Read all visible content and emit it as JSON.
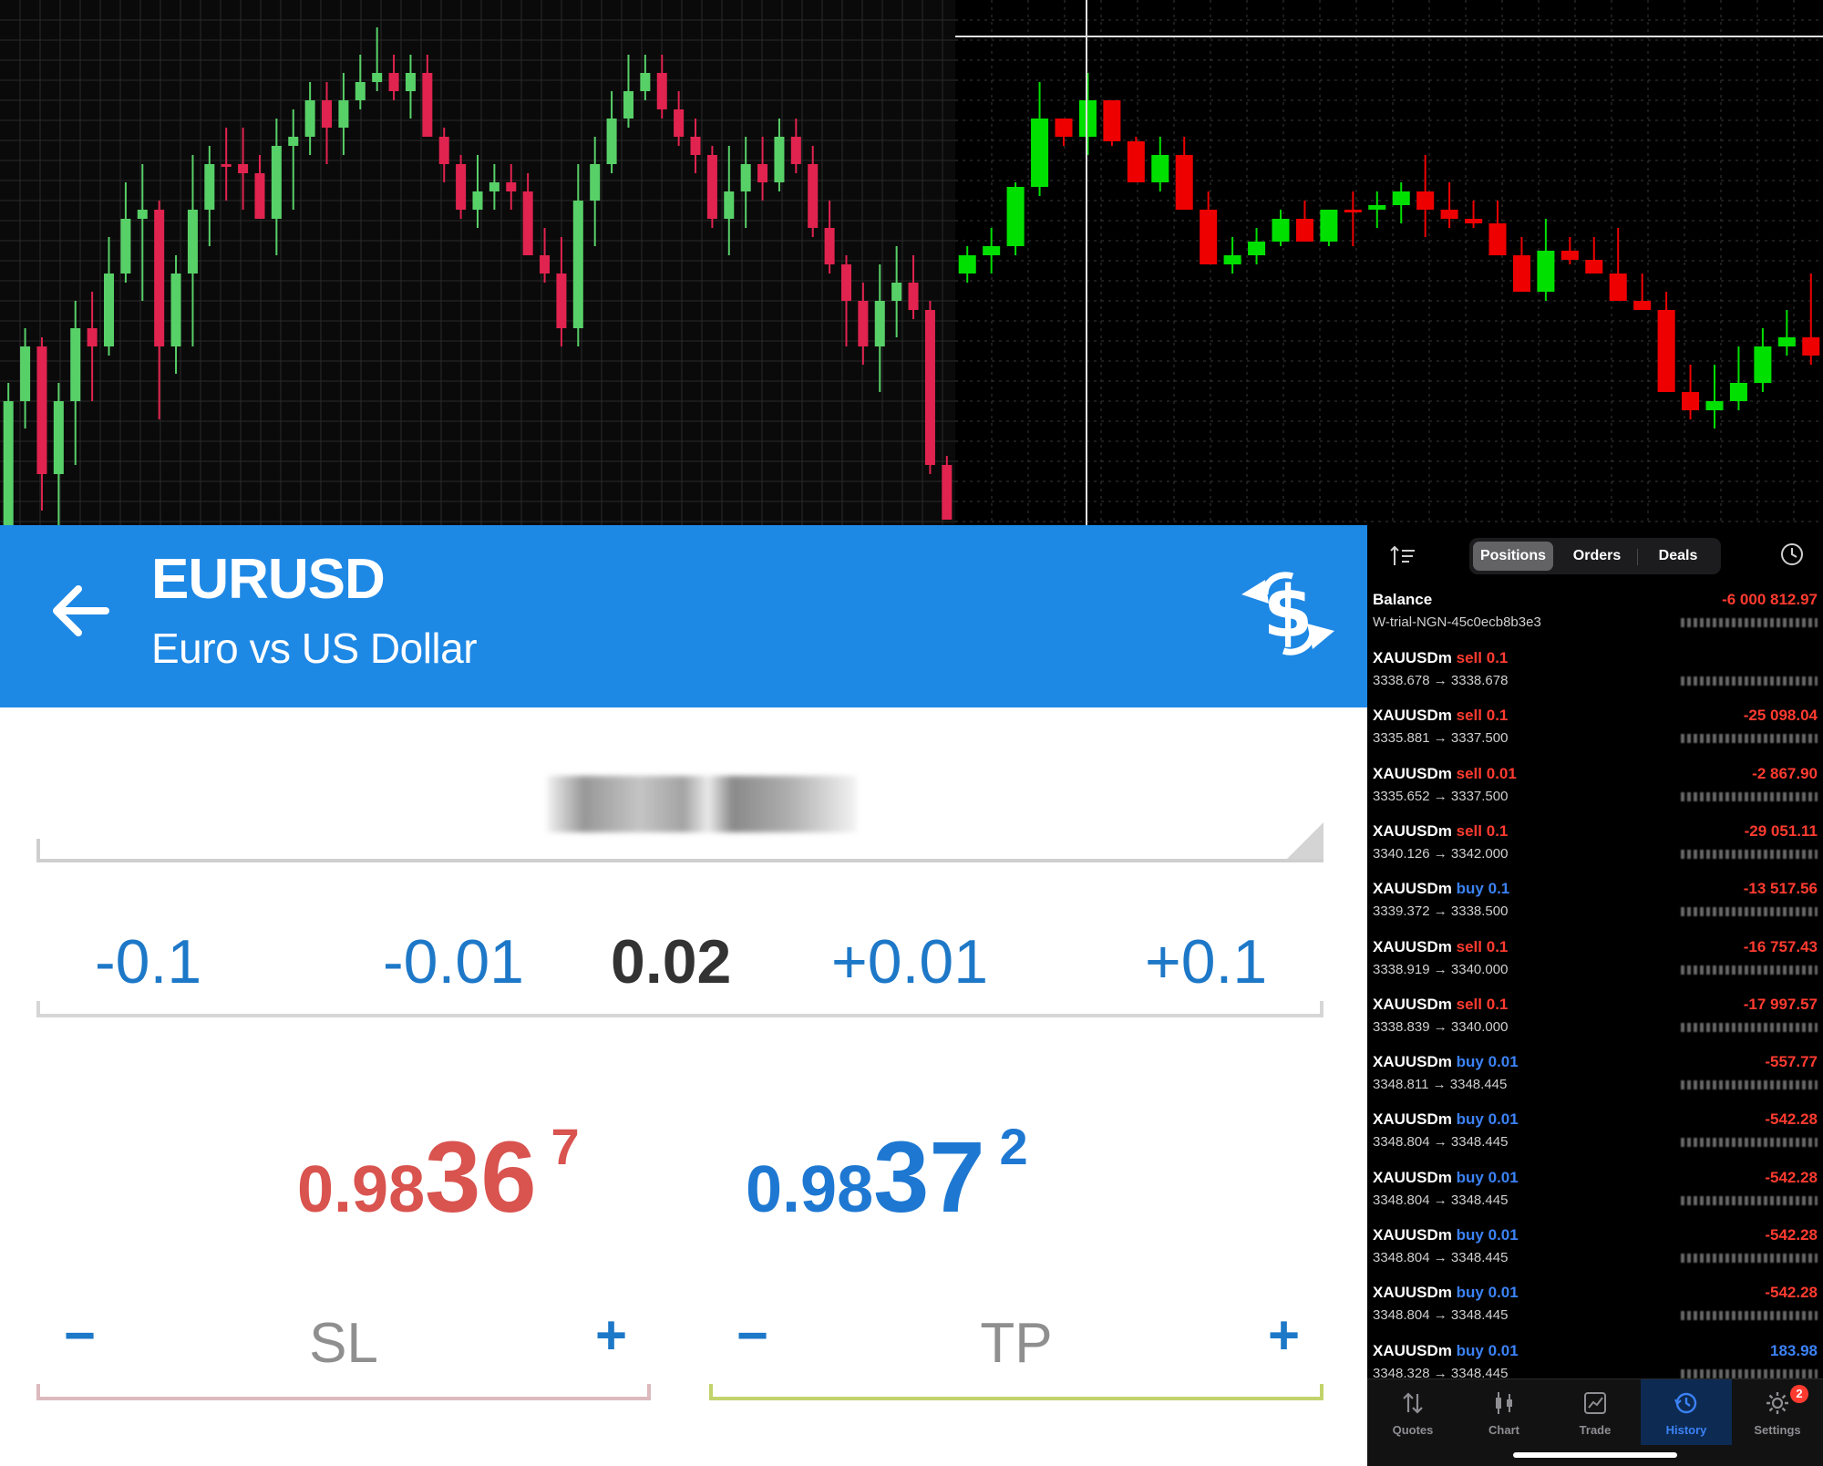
{
  "chart_data": [
    {
      "type": "candlestick",
      "title": "",
      "grid": true,
      "bullish_color": "#58d068",
      "bearish_color": "#e0234f",
      "background": "#0a0a0a",
      "ohlc": [
        [
          600,
          620,
          420,
          440
        ],
        [
          440,
          470,
          360,
          380
        ],
        [
          380,
          560,
          370,
          520
        ],
        [
          520,
          580,
          420,
          440
        ],
        [
          440,
          510,
          330,
          360
        ],
        [
          360,
          440,
          320,
          380
        ],
        [
          380,
          390,
          260,
          300
        ],
        [
          300,
          310,
          200,
          240
        ],
        [
          240,
          330,
          180,
          230
        ],
        [
          230,
          460,
          220,
          380
        ],
        [
          380,
          410,
          280,
          300
        ],
        [
          300,
          380,
          170,
          230
        ],
        [
          230,
          270,
          160,
          180
        ],
        [
          180,
          220,
          140,
          180
        ],
        [
          180,
          230,
          140,
          190
        ],
        [
          190,
          240,
          170,
          240
        ],
        [
          240,
          280,
          130,
          160
        ],
        [
          160,
          230,
          120,
          150
        ],
        [
          150,
          170,
          90,
          110
        ],
        [
          110,
          180,
          90,
          140
        ],
        [
          140,
          170,
          80,
          110
        ],
        [
          110,
          120,
          60,
          90
        ],
        [
          90,
          100,
          30,
          80
        ],
        [
          80,
          110,
          60,
          100
        ],
        [
          100,
          130,
          60,
          80
        ],
        [
          80,
          150,
          60,
          150
        ],
        [
          150,
          200,
          140,
          180
        ],
        [
          180,
          240,
          170,
          230
        ],
        [
          230,
          250,
          170,
          210
        ],
        [
          210,
          230,
          180,
          200
        ],
        [
          200,
          230,
          180,
          210
        ],
        [
          210,
          280,
          190,
          280
        ],
        [
          280,
          310,
          250,
          300
        ],
        [
          300,
          380,
          260,
          360
        ],
        [
          360,
          380,
          180,
          220
        ],
        [
          220,
          270,
          150,
          180
        ],
        [
          180,
          190,
          100,
          130
        ],
        [
          130,
          140,
          60,
          100
        ],
        [
          100,
          110,
          60,
          80
        ],
        [
          80,
          130,
          60,
          120
        ],
        [
          120,
          160,
          100,
          150
        ],
        [
          150,
          190,
          130,
          170
        ],
        [
          170,
          250,
          160,
          240
        ],
        [
          240,
          280,
          160,
          210
        ],
        [
          210,
          250,
          150,
          180
        ],
        [
          180,
          220,
          150,
          200
        ],
        [
          200,
          210,
          130,
          150
        ],
        [
          150,
          190,
          130,
          180
        ],
        [
          180,
          260,
          160,
          250
        ],
        [
          250,
          300,
          220,
          290
        ],
        [
          290,
          380,
          280,
          330
        ],
        [
          330,
          400,
          310,
          380
        ],
        [
          380,
          430,
          290,
          330
        ],
        [
          330,
          370,
          270,
          310
        ],
        [
          310,
          350,
          280,
          340
        ],
        [
          340,
          520,
          330,
          510
        ],
        [
          510,
          570,
          500,
          570
        ]
      ]
    },
    {
      "type": "candlestick",
      "title": "",
      "grid": true,
      "bullish_color": "#00e000",
      "bearish_color": "#ee0000",
      "background": "#000000",
      "ohlc": [
        [
          300,
          310,
          270,
          280
        ],
        [
          280,
          300,
          250,
          270
        ],
        [
          270,
          280,
          200,
          205
        ],
        [
          205,
          215,
          90,
          130
        ],
        [
          130,
          160,
          140,
          150
        ],
        [
          150,
          170,
          80,
          110
        ],
        [
          110,
          160,
          140,
          155
        ],
        [
          155,
          170,
          150,
          200
        ],
        [
          200,
          210,
          150,
          170
        ],
        [
          170,
          220,
          150,
          230
        ],
        [
          230,
          250,
          210,
          290
        ],
        [
          290,
          300,
          260,
          280
        ],
        [
          280,
          290,
          250,
          265
        ],
        [
          265,
          270,
          230,
          240
        ],
        [
          240,
          260,
          220,
          265
        ],
        [
          265,
          270,
          240,
          230
        ],
        [
          230,
          270,
          210,
          230
        ],
        [
          230,
          250,
          210,
          225
        ],
        [
          225,
          245,
          200,
          210
        ],
        [
          210,
          260,
          170,
          230
        ],
        [
          230,
          250,
          200,
          240
        ],
        [
          240,
          250,
          220,
          245
        ],
        [
          245,
          260,
          220,
          280
        ],
        [
          280,
          300,
          260,
          320
        ],
        [
          320,
          330,
          240,
          275
        ],
        [
          275,
          290,
          260,
          285
        ],
        [
          285,
          300,
          260,
          300
        ],
        [
          300,
          310,
          250,
          330
        ],
        [
          330,
          340,
          300,
          340
        ],
        [
          340,
          420,
          320,
          430
        ],
        [
          430,
          460,
          400,
          450
        ],
        [
          450,
          470,
          400,
          440
        ],
        [
          440,
          450,
          380,
          420
        ],
        [
          420,
          430,
          360,
          380
        ],
        [
          380,
          390,
          340,
          370
        ],
        [
          370,
          400,
          300,
          390
        ]
      ]
    }
  ],
  "order": {
    "symbol": "EURUSD",
    "description": "Euro vs US Dollar",
    "steps": {
      "minus_large": "-0.1",
      "minus_small": "-0.01",
      "volume": "0.02",
      "plus_small": "+0.01",
      "plus_large": "+0.1"
    },
    "bid": {
      "prefix": "0.98",
      "big": "36",
      "pip": "7"
    },
    "ask": {
      "prefix": "0.98",
      "big": "37",
      "pip": "2"
    },
    "sl": {
      "minus": "−",
      "label": "SL",
      "plus": "+"
    },
    "tp": {
      "minus": "−",
      "label": "TP",
      "plus": "+"
    },
    "colors": {
      "header": "#1e88e5",
      "bid": "#d9534f",
      "ask": "#1e78d2"
    }
  },
  "history": {
    "tabs": {
      "positions": "Positions",
      "orders": "Orders",
      "deals": "Deals"
    },
    "balance": {
      "title": "Balance",
      "account": "W-trial-NGN-45c0ecb8b3e3",
      "amount": "-6 000 812.97"
    },
    "deals": [
      {
        "symbol": "XAUUSDm",
        "side": "sell",
        "size": "0.1",
        "prices": "3338.678 → 3338.678",
        "profit": ""
      },
      {
        "symbol": "XAUUSDm",
        "side": "sell",
        "size": "0.1",
        "prices": "3335.881 → 3337.500",
        "profit": "-25 098.04"
      },
      {
        "symbol": "XAUUSDm",
        "side": "sell",
        "size": "0.01",
        "prices": "3335.652 → 3337.500",
        "profit": "-2 867.90"
      },
      {
        "symbol": "XAUUSDm",
        "side": "sell",
        "size": "0.1",
        "prices": "3340.126 → 3342.000",
        "profit": "-29 051.11"
      },
      {
        "symbol": "XAUUSDm",
        "side": "buy",
        "size": "0.1",
        "prices": "3339.372 → 3338.500",
        "profit": "-13 517.56"
      },
      {
        "symbol": "XAUUSDm",
        "side": "sell",
        "size": "0.1",
        "prices": "3338.919 → 3340.000",
        "profit": "-16 757.43"
      },
      {
        "symbol": "XAUUSDm",
        "side": "sell",
        "size": "0.1",
        "prices": "3338.839 → 3340.000",
        "profit": "-17 997.57"
      },
      {
        "symbol": "XAUUSDm",
        "side": "buy",
        "size": "0.01",
        "prices": "3348.811 → 3348.445",
        "profit": "-557.77"
      },
      {
        "symbol": "XAUUSDm",
        "side": "buy",
        "size": "0.01",
        "prices": "3348.804 → 3348.445",
        "profit": "-542.28"
      },
      {
        "symbol": "XAUUSDm",
        "side": "buy",
        "size": "0.01",
        "prices": "3348.804 → 3348.445",
        "profit": "-542.28"
      },
      {
        "symbol": "XAUUSDm",
        "side": "buy",
        "size": "0.01",
        "prices": "3348.804 → 3348.445",
        "profit": "-542.28"
      },
      {
        "symbol": "XAUUSDm",
        "side": "buy",
        "size": "0.01",
        "prices": "3348.804 → 3348.445",
        "profit": "-542.28"
      },
      {
        "symbol": "XAUUSDm",
        "side": "buy",
        "size": "0.01",
        "prices": "3348.328 → 3348.445",
        "profit": "183.98"
      }
    ],
    "nav": [
      {
        "label": "Quotes",
        "icon": "quotes-icon"
      },
      {
        "label": "Chart",
        "icon": "chart-icon"
      },
      {
        "label": "Trade",
        "icon": "trade-icon"
      },
      {
        "label": "History",
        "icon": "history-icon"
      },
      {
        "label": "Settings",
        "icon": "gear-icon"
      }
    ],
    "settings_badge": "2"
  }
}
